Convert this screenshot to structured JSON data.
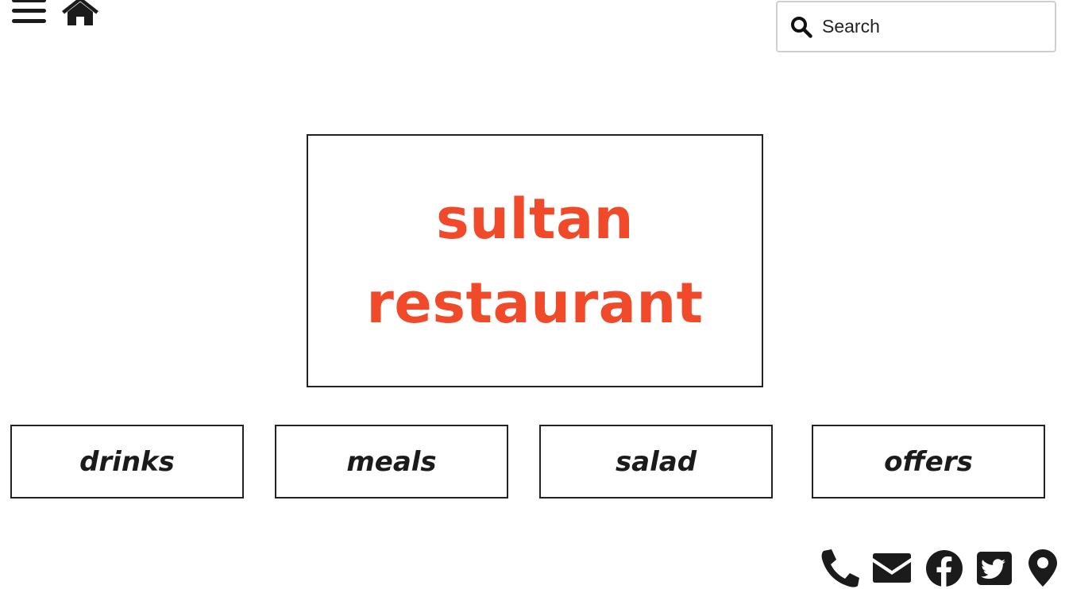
{
  "search": {
    "placeholder": "Search",
    "value": ""
  },
  "hero": {
    "line1": "sultan",
    "line2": "restaurant"
  },
  "categories": [
    {
      "label": "drinks"
    },
    {
      "label": "meals"
    },
    {
      "label": "salad"
    },
    {
      "label": "offers"
    }
  ],
  "icons": {
    "menu": "menu-icon",
    "home": "home-icon",
    "search": "search-icon",
    "phone": "phone-icon",
    "mail": "mail-icon",
    "facebook": "facebook-icon",
    "twitter": "twitter-icon",
    "map": "map-pin-icon"
  },
  "colors": {
    "brand": "#f04a2a",
    "text": "#1b1b1b",
    "border": "#222222",
    "search_border": "#cfcfcf"
  }
}
